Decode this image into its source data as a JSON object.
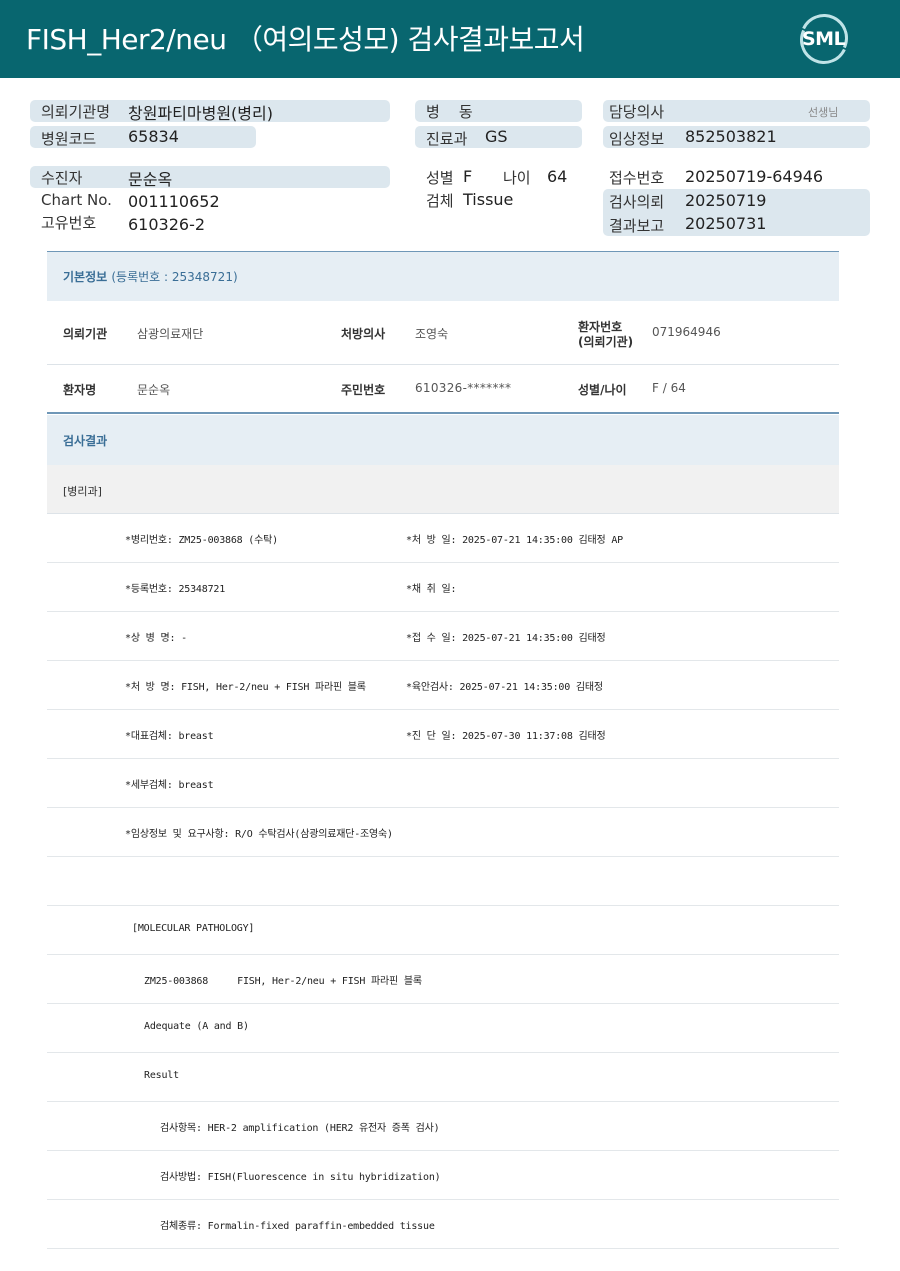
{
  "header": {
    "title": "FISH_Her2/neu （여의도성모) 검사결과보고서",
    "logo_text": "SML",
    "accent_color": "#08666f"
  },
  "request": {
    "institution_label": "의뢰기관명",
    "institution_value": "창원파티마병원(병리)",
    "hospital_code_label": "병원코드",
    "hospital_code_value": "65834",
    "ward_label": "병    동",
    "ward_value": "",
    "dept_label": "진료과",
    "dept_value": "GS",
    "doctor_label": "담당의사",
    "doctor_suffix": "선생님",
    "clinical_label": "임상정보",
    "clinical_value": "852503821"
  },
  "patient": {
    "name_label": "수진자",
    "name_value": "문순옥",
    "chart_label": "Chart No.",
    "chart_value": "001110652",
    "id_label": "고유번호",
    "id_value": "610326-2",
    "sex_label": "성별",
    "sex_value": "F",
    "age_label": "나이",
    "age_value": "64",
    "specimen_label": "검체",
    "specimen_value": "Tissue",
    "receipt_label": "접수번호",
    "receipt_value": "20250719-64946",
    "test_req_label": "검사의뢰",
    "test_req_value": "20250719",
    "report_label": "결과보고",
    "report_value": "20250731"
  },
  "basic_info": {
    "heading": "기본정보",
    "reg_no": "(등록번호 : 25348721)",
    "rows": [
      [
        {
          "label": "의뢰기관",
          "value": "삼광의료재단"
        },
        {
          "label": "처방의사",
          "value": "조영숙"
        },
        {
          "label": "환자번호 (의뢰기관)",
          "label_line1": "환자번호",
          "label_line2": "(의뢰기관)",
          "value": "071964946"
        }
      ],
      [
        {
          "label": "환자명",
          "value": "문순옥"
        },
        {
          "label": "주민번호",
          "value": "610326-*******"
        },
        {
          "label": "성별/나이",
          "value": "F / 64"
        }
      ]
    ]
  },
  "results": {
    "heading": "검사결과",
    "dept": "[병리과]",
    "fields": [
      {
        "left": "*병리번호: ZM25-003868 (수탁)",
        "right": "*처 방 일: 2025-07-21 14:35:00  김태정 AP"
      },
      {
        "left": "*등록번호: 25348721",
        "right": "*채 취 일:"
      },
      {
        "left": "*상 병 명: -",
        "right": "*접 수 일: 2025-07-21 14:35:00  김태정"
      },
      {
        "left": "*처 방 명: FISH, Her-2/neu + FISH 파라핀 블록",
        "right": "*육안검사: 2025-07-21 14:35:00  김태정"
      },
      {
        "left": "*대표검체: breast",
        "right": "*진 단 일: 2025-07-30 11:37:08  김태정"
      },
      {
        "left": "*세부검체: breast",
        "right": ""
      },
      {
        "left": "*임상정보 및 요구사항: R/O 수탁검사(삼광의료재단-조영숙)",
        "right": ""
      }
    ],
    "body_lines": [
      {
        "text": "",
        "indent": 0
      },
      {
        "text": "[MOLECULAR PATHOLOGY]",
        "indent": 0
      },
      {
        "text": "ZM25-003868     FISH, Her-2/neu + FISH 파라핀 블록",
        "indent": 1
      },
      {
        "text": "Adequate (A and B)",
        "indent": 1
      },
      {
        "text": "Result",
        "indent": 1
      },
      {
        "text": "검사항목: HER-2 amplification (HER2 유전자 증폭 검사)",
        "indent": 2
      },
      {
        "text": "검사방법: FISH(Fluorescence in situ hybridization)",
        "indent": 2
      },
      {
        "text": "검체종류: Formalin-fixed paraffin-embedded tissue",
        "indent": 2
      }
    ]
  }
}
